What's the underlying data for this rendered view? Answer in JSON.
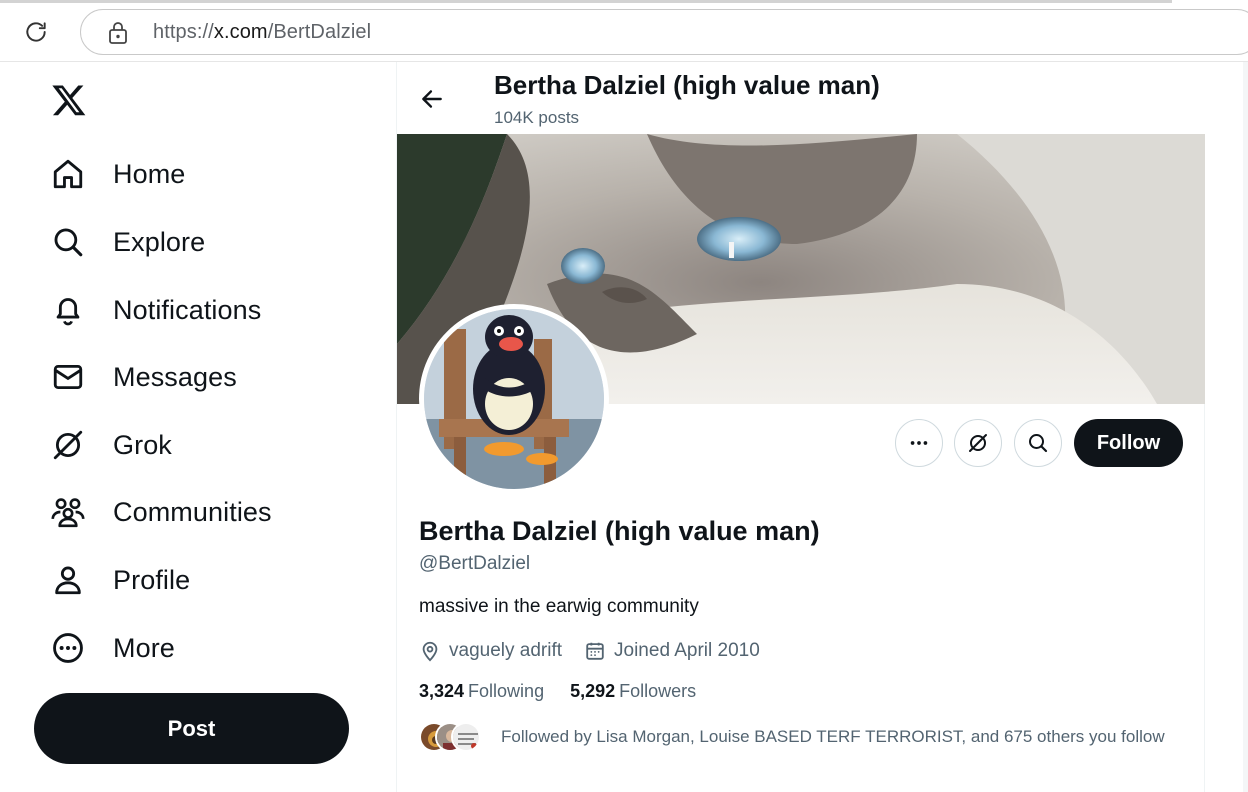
{
  "browser": {
    "url_scheme": "https://",
    "url_host": "x.com",
    "url_path": "/BertDalziel"
  },
  "sidebar": {
    "logo": "x-logo-icon",
    "items": [
      {
        "label": "Home",
        "icon": "home-icon"
      },
      {
        "label": "Explore",
        "icon": "search-icon"
      },
      {
        "label": "Notifications",
        "icon": "bell-icon"
      },
      {
        "label": "Messages",
        "icon": "envelope-icon"
      },
      {
        "label": "Grok",
        "icon": "grok-icon"
      },
      {
        "label": "Communities",
        "icon": "communities-icon"
      },
      {
        "label": "Profile",
        "icon": "person-icon"
      },
      {
        "label": "More",
        "icon": "more-circle-icon"
      }
    ],
    "post_label": "Post"
  },
  "header": {
    "name": "Bertha Dalziel (high value man)",
    "posts": "104K posts"
  },
  "profile": {
    "name": "Bertha Dalziel (high value man)",
    "handle": "@BertDalziel",
    "bio": "massive in the earwig community",
    "location": "vaguely adrift",
    "joined": "Joined April 2010",
    "following_count": "3,324",
    "following_label": "Following",
    "followers_count": "5,292",
    "followers_label": "Followers",
    "followed_by": "Followed by Lisa Morgan, Louise BASED TERF TERRORIST, and 675 others you follow",
    "follow_label": "Follow"
  },
  "colors": {
    "text": "#0f1419",
    "muted": "#536471",
    "border": "#cfd9de",
    "button_dark": "#0f1419"
  }
}
